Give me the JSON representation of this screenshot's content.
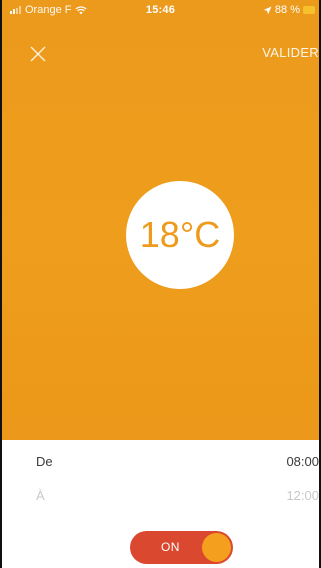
{
  "status_bar": {
    "carrier": "Orange F",
    "time": "15:46",
    "battery": "88 %"
  },
  "header": {
    "close_icon": "close-icon",
    "validate_label": "VALIDER"
  },
  "thermostat": {
    "temperature": "18°C"
  },
  "schedule": {
    "from_label": "De",
    "from_time": "08:00",
    "to_label": "À",
    "to_time": "12:00"
  },
  "toggle": {
    "label": "ON",
    "state": true
  },
  "colors": {
    "accent": "#ee9a1c",
    "toggle_on": "#d9482f",
    "knob": "#f4a01e"
  }
}
